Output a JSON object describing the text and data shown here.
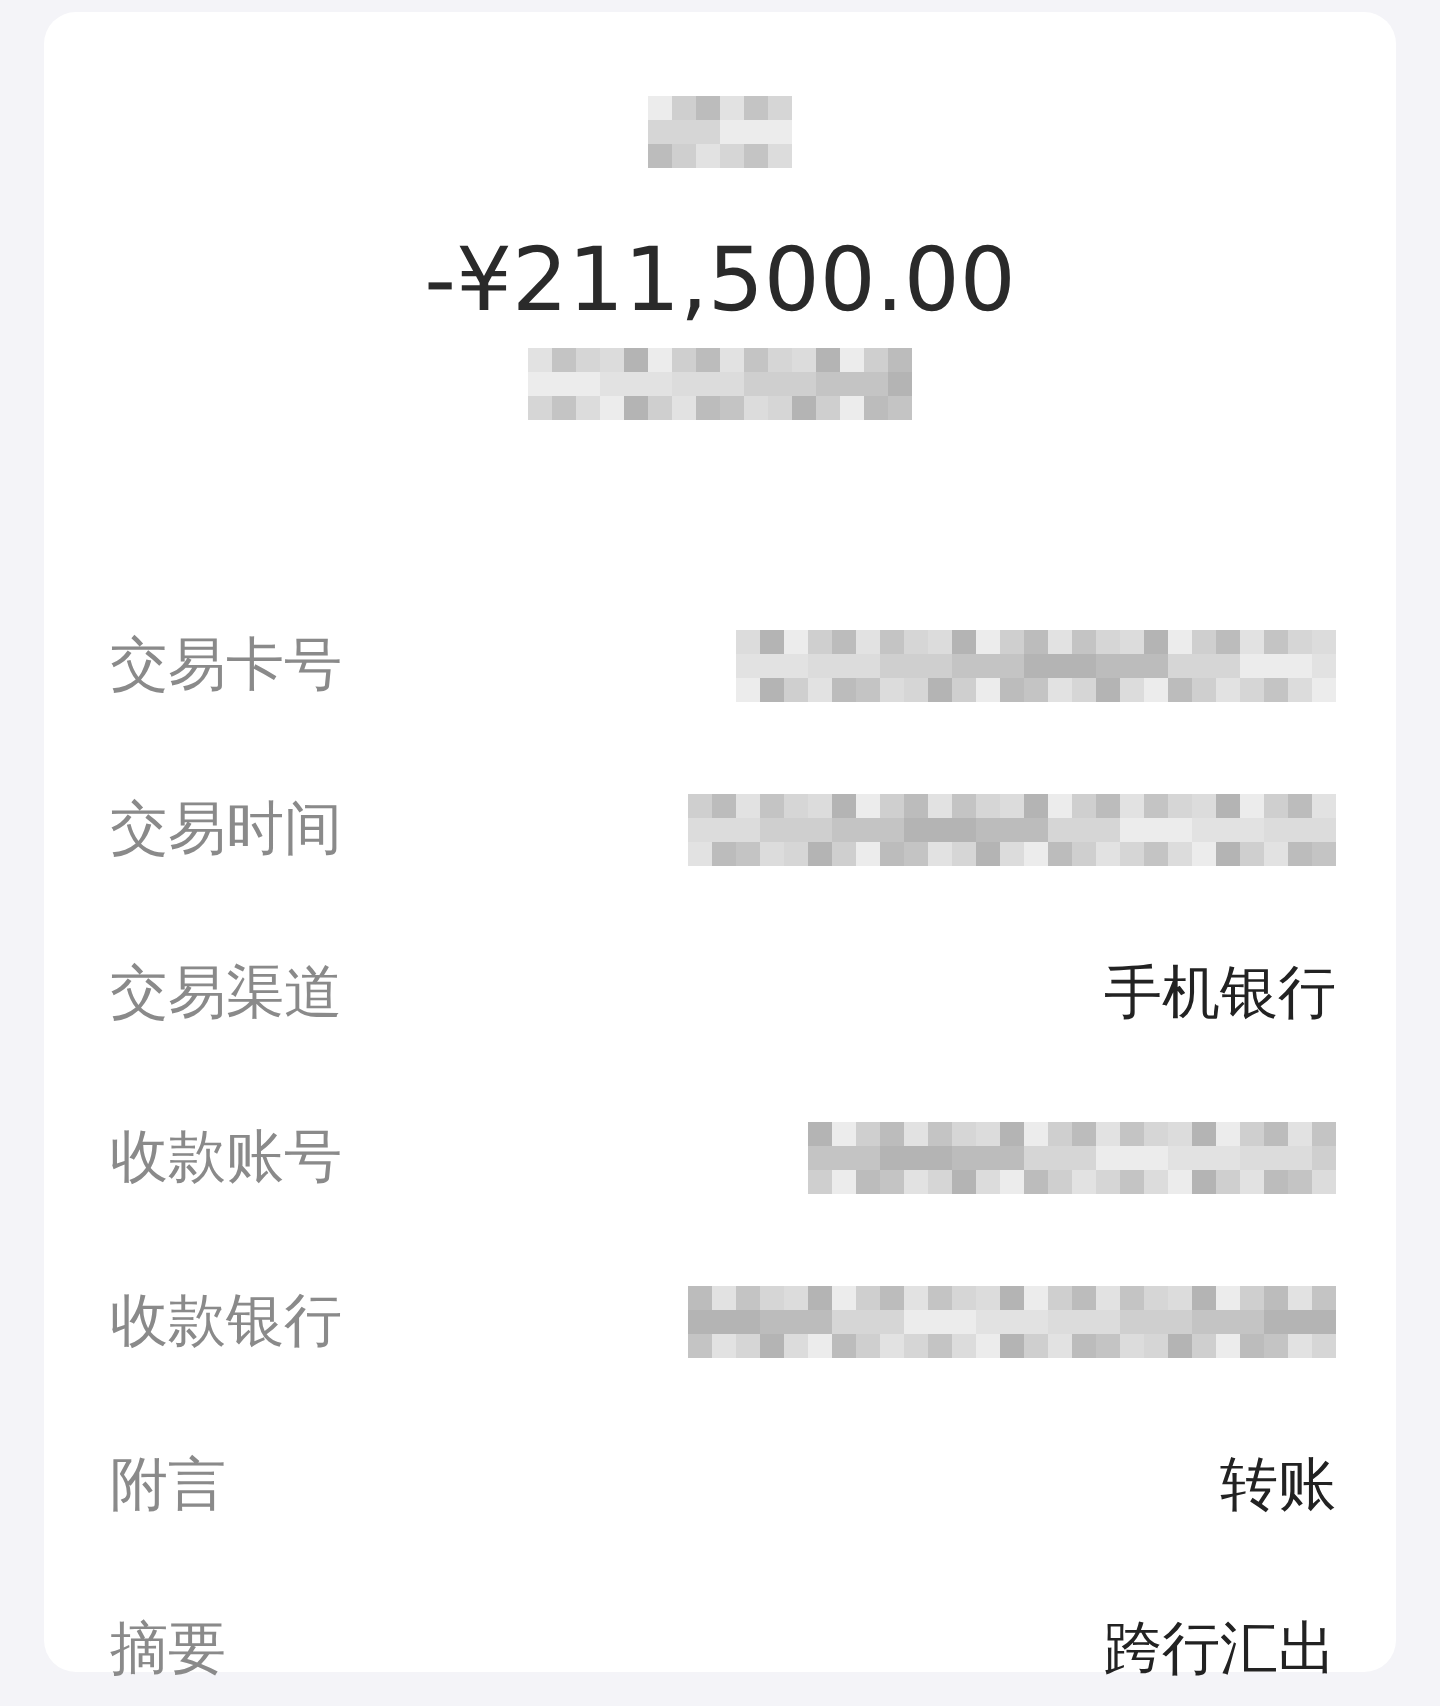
{
  "header": {
    "title": {
      "kind": "redacted"
    },
    "amount": "-¥211,500.00",
    "subtitle": {
      "kind": "redacted"
    }
  },
  "rows": [
    {
      "label": "交易卡号",
      "kind": "redacted"
    },
    {
      "label": "交易时间",
      "kind": "redacted"
    },
    {
      "label": "交易渠道",
      "kind": "text",
      "value": "手机银行"
    },
    {
      "label": "收款账号",
      "kind": "redacted"
    },
    {
      "label": "收款银行",
      "kind": "redacted"
    },
    {
      "label": "附言",
      "kind": "text",
      "value": "转账"
    },
    {
      "label": "摘要",
      "kind": "text",
      "value": "跨行汇出"
    }
  ]
}
